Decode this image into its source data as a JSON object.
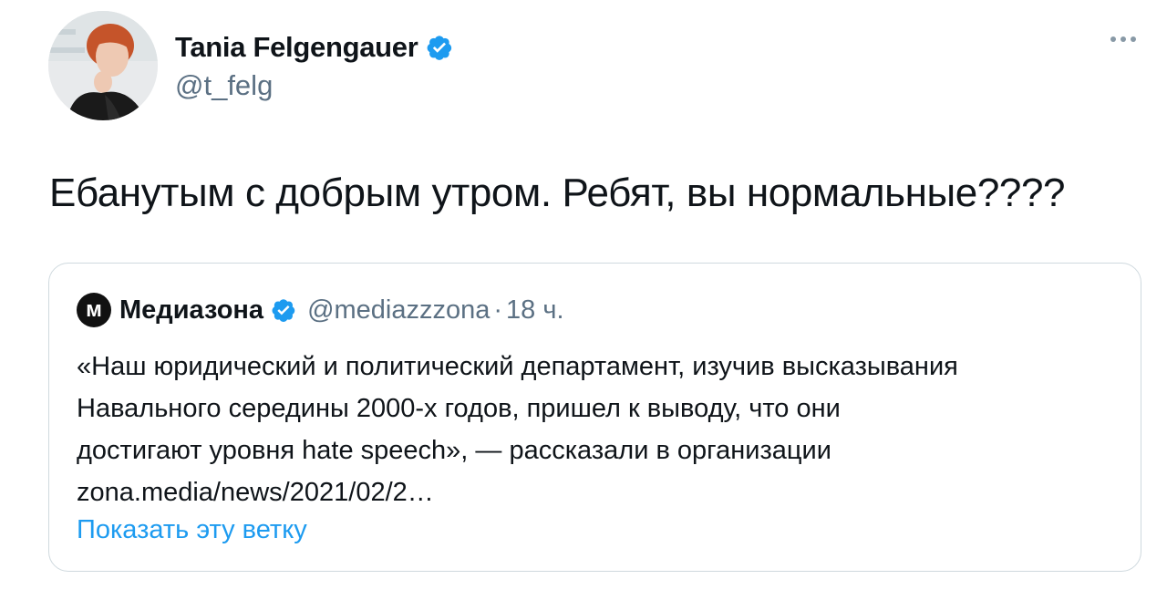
{
  "author": {
    "name": "Tania Felgengauer",
    "handle": "@t_felg",
    "verified": true,
    "avatar_icon": "profile-photo"
  },
  "tweet": {
    "text": "Ебанутым с добрым утром. Ребят, вы нормальные????"
  },
  "quote": {
    "logo_letter": "м",
    "name": "Медиазона",
    "handle": "@mediazzzona",
    "separator": "·",
    "time": "18 ч.",
    "lines": [
      "«Наш юридический и политический департамент, изучив высказывания",
      "Навального середины 2000-х годов, пришел к выводу, что они",
      "достигают уровня hate speech», — рассказали в организации",
      "zona.media/news/2021/02/2…"
    ],
    "show_thread": "Показать эту ветку"
  },
  "colors": {
    "verified_blue": "#1d9bf0",
    "link_blue": "#1d9bf0",
    "secondary_text": "#5b7083",
    "border": "#cfd9de"
  }
}
